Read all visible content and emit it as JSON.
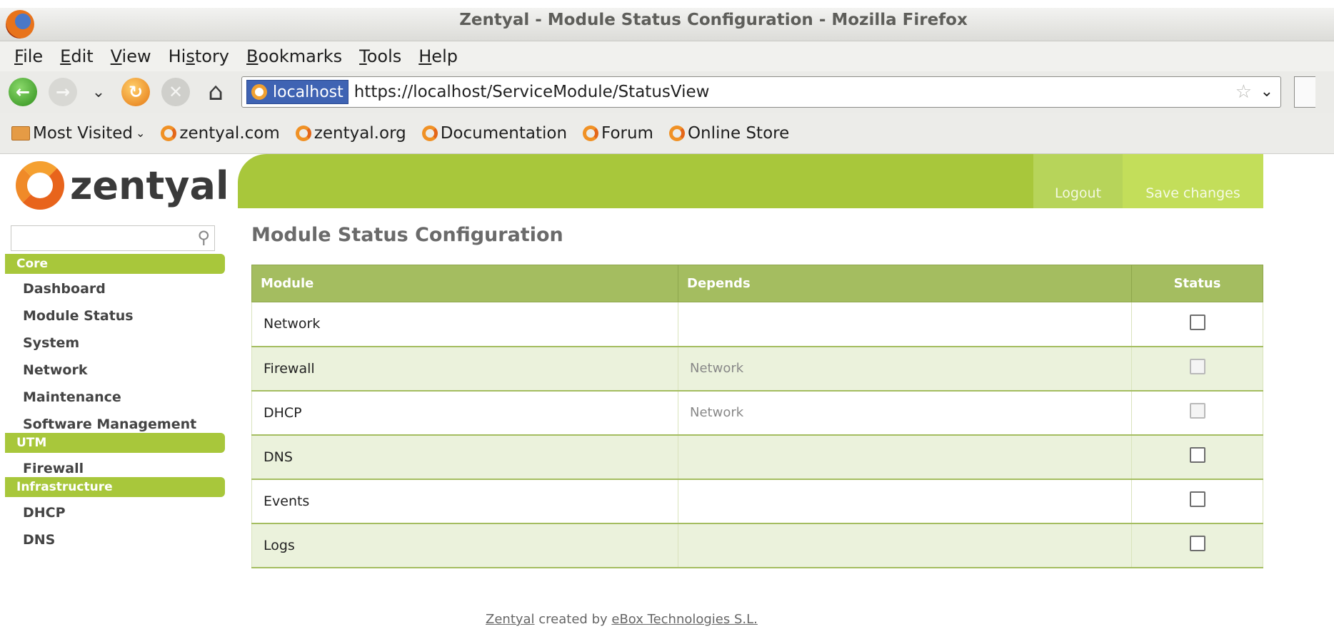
{
  "window": {
    "title": "Zentyal - Module Status Configuration - Mozilla Firefox"
  },
  "menu": {
    "items": [
      {
        "pre": "",
        "accel": "F",
        "post": "ile"
      },
      {
        "pre": "",
        "accel": "E",
        "post": "dit"
      },
      {
        "pre": "",
        "accel": "V",
        "post": "iew"
      },
      {
        "pre": "Hi",
        "accel": "s",
        "post": "tory"
      },
      {
        "pre": "",
        "accel": "B",
        "post": "ookmarks"
      },
      {
        "pre": "",
        "accel": "T",
        "post": "ools"
      },
      {
        "pre": "",
        "accel": "H",
        "post": "elp"
      }
    ]
  },
  "nav": {
    "site_identity": "localhost",
    "url": "https://localhost/ServiceModule/StatusView"
  },
  "bookmarks": {
    "most_visited": "Most Visited",
    "items": [
      "zentyal.com",
      "zentyal.org",
      "Documentation",
      "Forum",
      "Online Store"
    ]
  },
  "app": {
    "logo_text": "zentyal",
    "logout": "Logout",
    "save_changes": "Save changes",
    "search_placeholder": ""
  },
  "sidebar": {
    "sections": [
      {
        "title": "Core",
        "items": [
          "Dashboard",
          "Module Status",
          "System",
          "Network",
          "Maintenance",
          "Software Management"
        ]
      },
      {
        "title": "UTM",
        "items": [
          "Firewall"
        ]
      },
      {
        "title": "Infrastructure",
        "items": [
          "DHCP",
          "DNS"
        ]
      }
    ]
  },
  "main": {
    "title": "Module Status Configuration",
    "columns": [
      "Module",
      "Depends",
      "Status"
    ],
    "rows": [
      {
        "module": "Network",
        "depends": "",
        "enabled": false,
        "disabled": false
      },
      {
        "module": "Firewall",
        "depends": "Network",
        "enabled": false,
        "disabled": true
      },
      {
        "module": "DHCP",
        "depends": "Network",
        "enabled": false,
        "disabled": true
      },
      {
        "module": "DNS",
        "depends": "",
        "enabled": false,
        "disabled": false
      },
      {
        "module": "Events",
        "depends": "",
        "enabled": false,
        "disabled": false
      },
      {
        "module": "Logs",
        "depends": "",
        "enabled": false,
        "disabled": false
      }
    ]
  },
  "footer": {
    "brand": "Zentyal",
    "middle": " created by ",
    "company": "eBox Technologies S.L."
  },
  "colors": {
    "accent_green": "#a8c73b",
    "table_header": "#a4bd60",
    "alt_row": "#ebf2dc",
    "url_identity_blue": "#3f63b3"
  }
}
